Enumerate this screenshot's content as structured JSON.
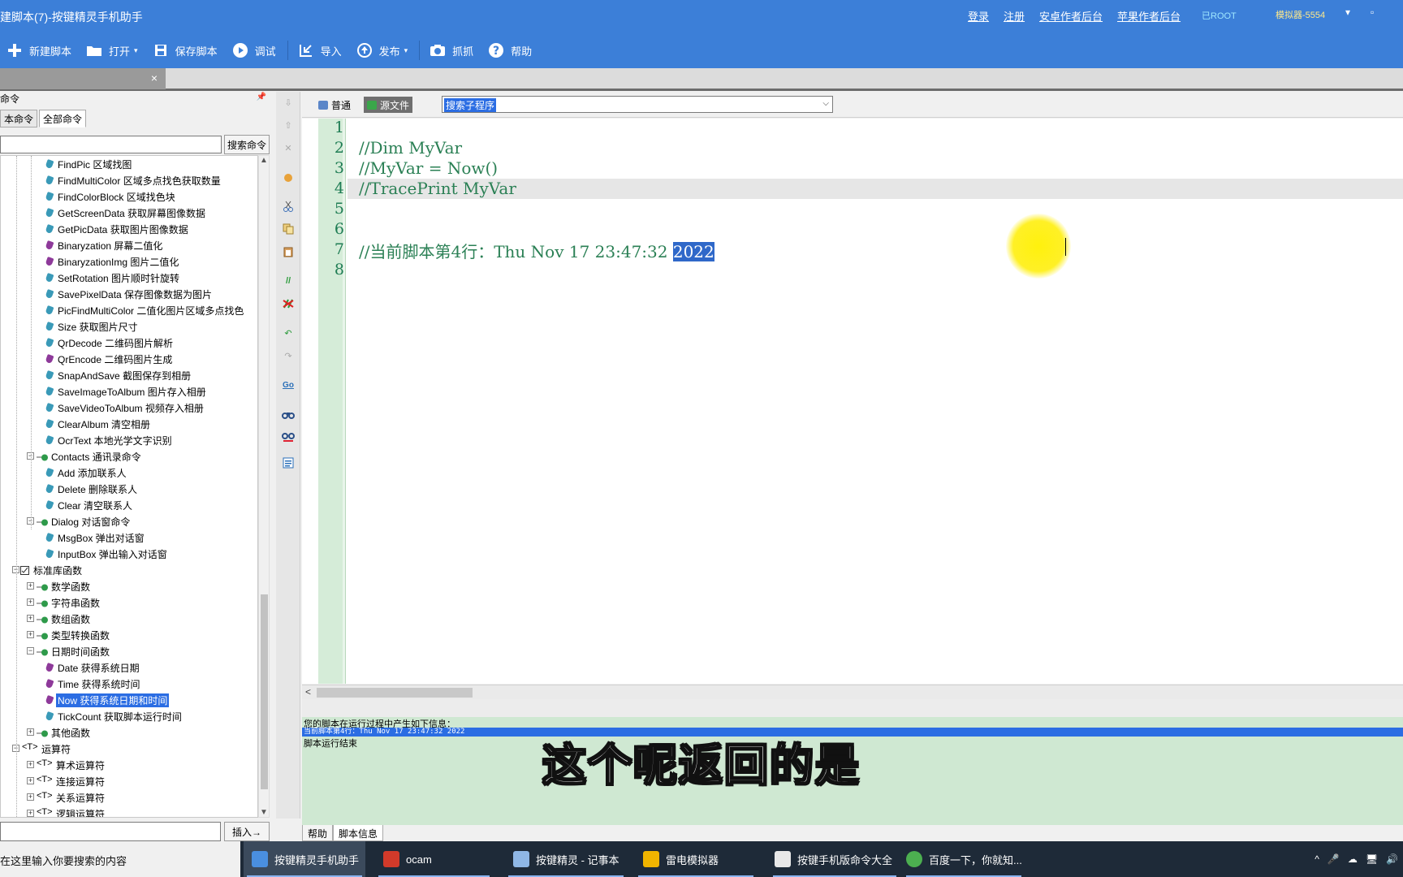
{
  "window": {
    "title": "建脚本(7)-按键精灵手机助手",
    "links": [
      "登录",
      "注册",
      "安卓作者后台",
      "苹果作者后台"
    ],
    "root_label": "已ROOT",
    "simulator": "模拟器-5554",
    "controls": [
      "▾",
      "▫"
    ]
  },
  "toolbar": {
    "items": [
      {
        "label": "新建脚本",
        "icon": "plus-icon"
      },
      {
        "label": "打开",
        "icon": "folder-icon",
        "dropdown": true
      },
      {
        "label": "保存脚本",
        "icon": "save-icon"
      },
      {
        "label": "调试",
        "icon": "play-icon"
      },
      {
        "label": "导入",
        "icon": "import-icon"
      },
      {
        "label": "发布",
        "icon": "publish-icon",
        "dropdown": true
      },
      {
        "label": "抓抓",
        "icon": "camera-icon"
      },
      {
        "label": "帮助",
        "icon": "help-icon"
      }
    ]
  },
  "doc_tab": {
    "close": "×"
  },
  "left_panel": {
    "title": "命令",
    "pin": "📌",
    "tabs": [
      "本命令",
      "全部命令"
    ],
    "search_button": "搜索命令",
    "insert_button": "插入→",
    "tree": [
      {
        "label": "FindPic 区域找图",
        "level": 2,
        "kind": "leaf",
        "color": "#3a9ab8"
      },
      {
        "label": "FindMultiColor 区域多点找色获取数量",
        "level": 2,
        "kind": "leaf",
        "color": "#3a9ab8"
      },
      {
        "label": "FindColorBlock 区域找色块",
        "level": 2,
        "kind": "leaf",
        "color": "#3a9ab8"
      },
      {
        "label": "GetScreenData 获取屏幕图像数据",
        "level": 2,
        "kind": "leaf",
        "color": "#3a9ab8"
      },
      {
        "label": "GetPicData 获取图片图像数据",
        "level": 2,
        "kind": "leaf",
        "color": "#3a9ab8"
      },
      {
        "label": "Binaryzation 屏幕二值化",
        "level": 2,
        "kind": "leaf",
        "color": "#8e3a9a"
      },
      {
        "label": "BinaryzationImg 图片二值化",
        "level": 2,
        "kind": "leaf",
        "color": "#8e3a9a"
      },
      {
        "label": "SetRotation 图片顺时针旋转",
        "level": 2,
        "kind": "leaf",
        "color": "#3a9ab8"
      },
      {
        "label": "SavePixelData 保存图像数据为图片",
        "level": 2,
        "kind": "leaf",
        "color": "#3a9ab8"
      },
      {
        "label": "PicFindMultiColor 二值化图片区域多点找色",
        "level": 2,
        "kind": "leaf",
        "color": "#3a9ab8"
      },
      {
        "label": "Size 获取图片尺寸",
        "level": 2,
        "kind": "leaf",
        "color": "#3a9ab8"
      },
      {
        "label": "QrDecode 二维码图片解析",
        "level": 2,
        "kind": "leaf",
        "color": "#3a9ab8"
      },
      {
        "label": "QrEncode 二维码图片生成",
        "level": 2,
        "kind": "leaf",
        "color": "#8e3a9a"
      },
      {
        "label": "SnapAndSave 截图保存到相册",
        "level": 2,
        "kind": "leaf",
        "color": "#3a9ab8"
      },
      {
        "label": "SaveImageToAlbum 图片存入相册",
        "level": 2,
        "kind": "leaf",
        "color": "#3a9ab8"
      },
      {
        "label": "SaveVideoToAlbum 视频存入相册",
        "level": 2,
        "kind": "leaf",
        "color": "#3a9ab8"
      },
      {
        "label": "ClearAlbum 清空相册",
        "level": 2,
        "kind": "leaf",
        "color": "#3a9ab8"
      },
      {
        "label": "OcrText 本地光学文字识别",
        "level": 2,
        "kind": "leaf",
        "color": "#3a9ab8"
      },
      {
        "label": "Contacts 通讯录命令",
        "level": 1,
        "kind": "cat",
        "expand": "−"
      },
      {
        "label": "Add 添加联系人",
        "level": 2,
        "kind": "leaf",
        "color": "#3a9ab8"
      },
      {
        "label": "Delete 删除联系人",
        "level": 2,
        "kind": "leaf",
        "color": "#3a9ab8"
      },
      {
        "label": "Clear 清空联系人",
        "level": 2,
        "kind": "leaf",
        "color": "#3a9ab8"
      },
      {
        "label": "Dialog 对话窗命令",
        "level": 1,
        "kind": "cat",
        "expand": "−"
      },
      {
        "label": "MsgBox 弹出对话窗",
        "level": 2,
        "kind": "leaf",
        "color": "#3a9ab8"
      },
      {
        "label": "InputBox 弹出输入对话窗",
        "level": 2,
        "kind": "leaf",
        "color": "#3a9ab8"
      },
      {
        "label": "标准库函数",
        "level": 0,
        "kind": "root",
        "expand": "−"
      },
      {
        "label": "数学函数",
        "level": 1,
        "kind": "cat",
        "expand": "+"
      },
      {
        "label": "字符串函数",
        "level": 1,
        "kind": "cat",
        "expand": "+"
      },
      {
        "label": "数组函数",
        "level": 1,
        "kind": "cat",
        "expand": "+"
      },
      {
        "label": "类型转换函数",
        "level": 1,
        "kind": "cat",
        "expand": "+"
      },
      {
        "label": "日期时间函数",
        "level": 1,
        "kind": "cat",
        "expand": "−"
      },
      {
        "label": "Date 获得系统日期",
        "level": 2,
        "kind": "leaf",
        "color": "#8e3a9a"
      },
      {
        "label": "Time 获得系统时间",
        "level": 2,
        "kind": "leaf",
        "color": "#8e3a9a"
      },
      {
        "label": "Now 获得系统日期和时间",
        "level": 2,
        "kind": "leaf",
        "color": "#8e3a9a",
        "selected": true
      },
      {
        "label": "TickCount 获取脚本运行时间",
        "level": 2,
        "kind": "leaf",
        "color": "#3a9ab8"
      },
      {
        "label": "其他函数",
        "level": 1,
        "kind": "cat",
        "expand": "+"
      },
      {
        "label": "运算符",
        "level": 0,
        "kind": "op",
        "expand": "−"
      },
      {
        "label": "算术运算符",
        "level": 1,
        "kind": "op",
        "expand": "+"
      },
      {
        "label": "连接运算符",
        "level": 1,
        "kind": "op",
        "expand": "+"
      },
      {
        "label": "关系运算符",
        "level": 1,
        "kind": "op",
        "expand": "+"
      },
      {
        "label": "逻辑运算符",
        "level": 1,
        "kind": "op",
        "expand": "+"
      }
    ]
  },
  "editor": {
    "view_modes": [
      "普通",
      "源文件"
    ],
    "subroutine_combo": "搜索子程序",
    "line_numbers": [
      "1",
      "2",
      "3",
      "4",
      "5",
      "6",
      "7",
      "8"
    ],
    "lines": [
      "",
      "//Dim MyVar",
      "//MyVar = Now()",
      "//TracePrint MyVar",
      "",
      "",
      "//当前脚本第4行：Thu Nov 17 23:47:32 ",
      ""
    ],
    "selected_text": "2022"
  },
  "output": {
    "lines": [
      "您的脚本在运行过程中产生如下信息：",
      "当前脚本第4行：Thu Nov 17 23:47:32 2022",
      "脚本运行结束"
    ],
    "tabs": [
      "帮助",
      "脚本信息"
    ]
  },
  "subtitle": "这个呢返回的是",
  "taskbar": {
    "search_placeholder": "在这里输入你要搜索的内容",
    "items": [
      {
        "label": "按键精灵手机助手",
        "color": "#4a8fe0",
        "active": true
      },
      {
        "label": "ocam",
        "color": "#d23a2a"
      },
      {
        "label": "按键精灵 - 记事本",
        "color": "#8fb7e6"
      },
      {
        "label": "雷电模拟器",
        "color": "#f0b400"
      },
      {
        "label": "按键手机版命令大全",
        "color": "#e8e8e8"
      },
      {
        "label": "百度一下，你就知...",
        "color": "#4caf50"
      }
    ],
    "tray": [
      "^",
      "🎤",
      "☁",
      "🖥",
      "🔊"
    ]
  }
}
